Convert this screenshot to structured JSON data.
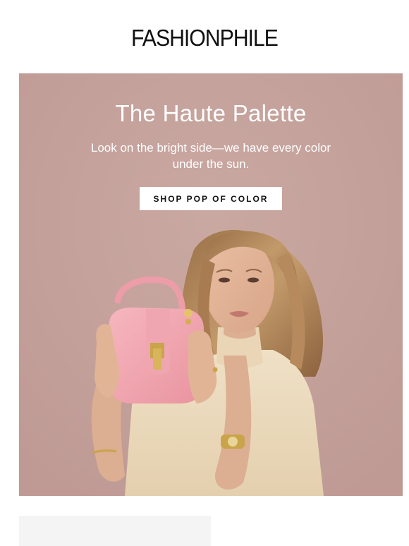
{
  "brand": {
    "logo_text": "FASHIONPHILE"
  },
  "hero": {
    "title": "The Haute Palette",
    "subtitle": "Look on the bright side—we have every color under the sun.",
    "cta_label": "SHOP POP OF COLOR",
    "image_alt": "Woman holding a pink leather handbag",
    "colors": {
      "background": "#c5a29c",
      "bag": "#f2a9b3",
      "sweater": "#eddcc0",
      "text": "#ffffff"
    }
  }
}
